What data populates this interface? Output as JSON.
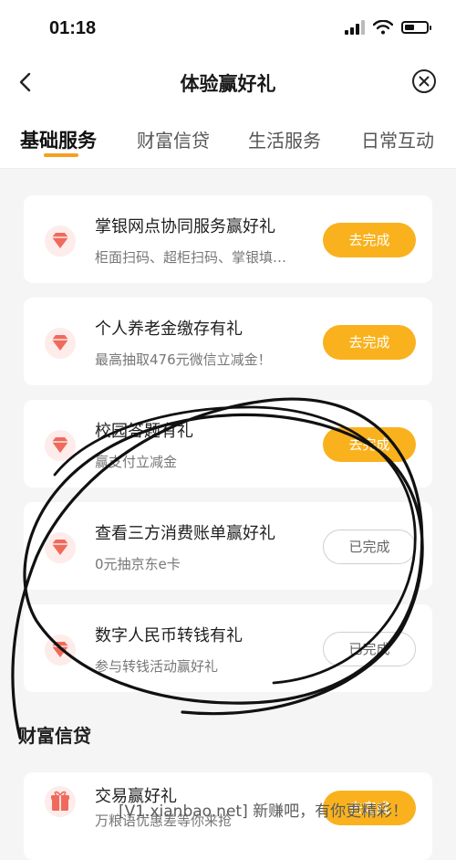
{
  "status": {
    "time": "01:18"
  },
  "nav": {
    "title": "体验赢好礼"
  },
  "tabs": [
    {
      "label": "基础服务",
      "active": true
    },
    {
      "label": "财富信贷",
      "active": false
    },
    {
      "label": "生活服务",
      "active": false
    },
    {
      "label": "日常互动",
      "active": false
    }
  ],
  "tasks": [
    {
      "title": "掌银网点协同服务赢好礼",
      "subtitle": "柜面扫码、超柜扫码、掌银填…",
      "button": "去完成",
      "state": "todo",
      "icon": "diamond-icon"
    },
    {
      "title": "个人养老金缴存有礼",
      "subtitle": "最高抽取476元微信立减金！",
      "button": "去完成",
      "state": "todo",
      "icon": "diamond-icon"
    },
    {
      "title": "校园答题有礼",
      "subtitle": "赢支付立减金",
      "button": "去完成",
      "state": "todo",
      "icon": "diamond-icon"
    },
    {
      "title": "查看三方消费账单赢好礼",
      "subtitle": "0元抽京东e卡",
      "button": "已完成",
      "state": "done",
      "icon": "diamond-icon"
    },
    {
      "title": "数字人民币转钱有礼",
      "subtitle": "参与转钱活动赢好礼",
      "button": "已完成",
      "state": "done",
      "icon": "diamond-icon"
    }
  ],
  "section2": {
    "title": "财富信贷",
    "tasks": [
      {
        "title": "交易赢好礼",
        "subtitle": "万粮语优惠差等你来抢",
        "button": "去完成",
        "state": "todo",
        "icon": "gift-icon"
      }
    ]
  },
  "watermark": "[V1.xianbao.net] 新赚吧，有你更精彩！",
  "colors": {
    "accent": "#f9b21d",
    "icon": "#f06a5c",
    "underline": "#f5a020"
  }
}
